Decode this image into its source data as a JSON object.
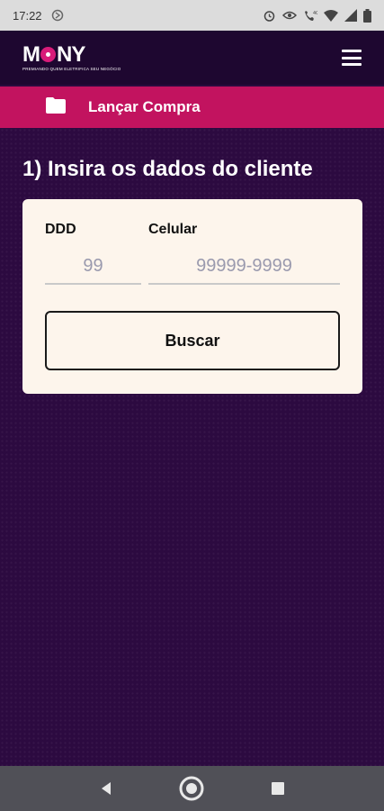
{
  "status_bar": {
    "time": "17:22"
  },
  "header": {
    "logo_text": "MONY",
    "logo_tagline": "PREMIANDO QUEM ELETRIFICA SEU NEGÓCIO",
    "menu_icon": "hamburger-menu-icon"
  },
  "section_bar": {
    "icon": "folder-icon",
    "title": "Lançar Compra"
  },
  "main": {
    "step_title": "1) Insira os dados do cliente",
    "ddd": {
      "label": "DDD",
      "placeholder": "99",
      "value": ""
    },
    "celular": {
      "label": "Celular",
      "placeholder": "99999-9999",
      "value": ""
    },
    "search_button": "Buscar"
  },
  "colors": {
    "header_bg": "#1e0730",
    "section_bar_bg": "#c2135f",
    "content_bg": "#2c0a40",
    "card_bg": "#fdf5ec",
    "accent": "#d81b79"
  },
  "nav": {
    "back_icon": "back-triangle-icon",
    "home_icon": "home-circle-icon",
    "recents_icon": "recents-square-icon"
  }
}
